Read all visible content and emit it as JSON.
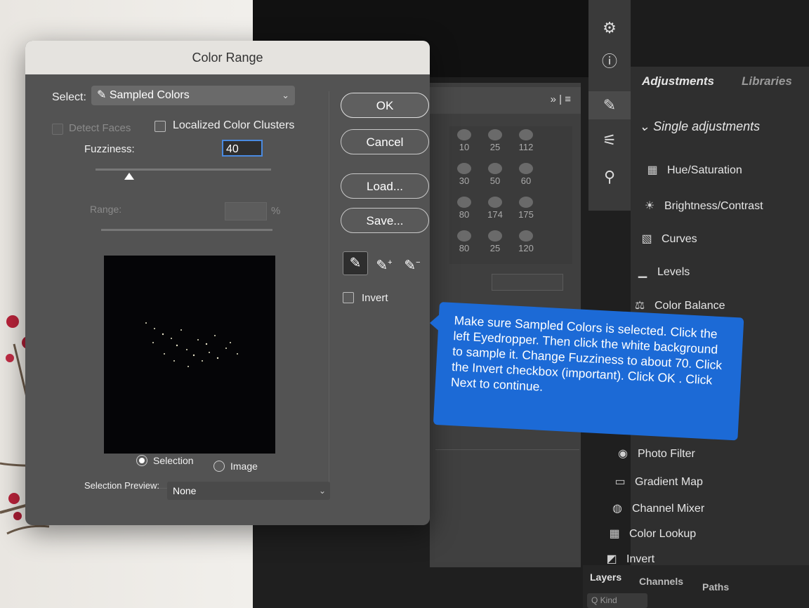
{
  "dialog": {
    "title": "Color Range",
    "select_label": "Select:",
    "select_value": "Sampled Colors",
    "detect_faces": "Detect Faces",
    "localized": "Localized Color Clusters",
    "fuzziness_label": "Fuzziness:",
    "fuzziness_value": "40",
    "range_label": "Range:",
    "range_unit": "%",
    "radio_selection": "Selection",
    "radio_image": "Image",
    "preview_label": "Selection Preview:",
    "preview_value": "None",
    "btn_ok": "OK",
    "btn_cancel": "Cancel",
    "btn_load": "Load...",
    "btn_save": "Save...",
    "invert": "Invert"
  },
  "tooltip": {
    "text": "Make sure Sampled Colors is selected. Click the left Eyedropper. Then click the white background to sample it. Change Fuzziness to about 70. Click the Invert checkbox (important). Click OK . Click Next to continue."
  },
  "brushes": [
    "10",
    "25",
    "112",
    "30",
    "50",
    "60",
    "80",
    "174",
    "175",
    "80",
    "25",
    "120"
  ],
  "panel": {
    "tab_adjustments": "Adjustments",
    "tab_libraries": "Libraries",
    "single": "Single adjustments",
    "items": [
      {
        "label": "Hue/Saturation",
        "icon": "hue-saturation-icon"
      },
      {
        "label": "Brightness/Contrast",
        "icon": "brightness-icon"
      },
      {
        "label": "Curves",
        "icon": "curves-icon"
      },
      {
        "label": "Levels",
        "icon": "levels-icon"
      },
      {
        "label": "Color Balance",
        "icon": "balance-icon"
      },
      {
        "label": "Photo Filter",
        "icon": "photo-filter-icon"
      },
      {
        "label": "Gradient Map",
        "icon": "gradient-map-icon"
      },
      {
        "label": "Channel Mixer",
        "icon": "channel-mixer-icon"
      },
      {
        "label": "Color Lookup",
        "icon": "color-lookup-icon"
      },
      {
        "label": "Invert",
        "icon": "invert-icon"
      }
    ]
  },
  "bottom_tabs": {
    "layers": "Layers",
    "channels": "Channels",
    "paths": "Paths",
    "kind": "Q Kind"
  },
  "colors": {
    "tooltip": "#1c6ad6",
    "focus": "#4a8ae0",
    "dialog": "#535353"
  }
}
